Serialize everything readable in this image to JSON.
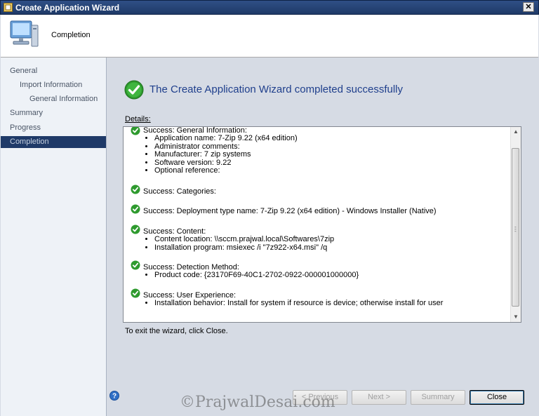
{
  "window": {
    "title": "Create Application Wizard",
    "close_glyph": "✕"
  },
  "header": {
    "page_title": "Completion",
    "icon": "computer-wizard-icon"
  },
  "nav": [
    {
      "label": "General"
    },
    {
      "label": "Import Information"
    },
    {
      "label": "General Information"
    },
    {
      "label": "Summary"
    },
    {
      "label": "Progress"
    },
    {
      "label": "Completion",
      "active": true
    }
  ],
  "main": {
    "headline": "The Create Application Wizard completed successfully",
    "details_label": "Details:",
    "entries": [
      {
        "title": "Success: General Information:",
        "items": [
          "Application name: 7-Zip 9.22 (x64 edition)",
          "Administrator comments:",
          "Manufacturer: 7 zip systems",
          "Software version: 9.22",
          "Optional reference:"
        ]
      },
      {
        "title": "Success: Categories:",
        "items": []
      },
      {
        "title": "Success: Deployment type name: 7-Zip 9.22 (x64 edition) - Windows Installer (Native)",
        "items": []
      },
      {
        "title": "Success: Content:",
        "items": [
          "Content location: \\\\sccm.prajwal.local\\Softwares\\7zip",
          "Installation program: msiexec /i \"7z922-x64.msi\" /q"
        ]
      },
      {
        "title": "Success: Detection Method:",
        "items": [
          "Product code: {23170F69-40C1-2702-0922-000001000000}"
        ]
      },
      {
        "title": "Success: User Experience:",
        "items": [
          "Installation behavior: Install for system if resource is device; otherwise install for user"
        ]
      }
    ],
    "exit_text": "To exit the wizard, click Close."
  },
  "buttons": {
    "previous": "< Previous",
    "next": "Next >",
    "summary": "Summary",
    "close": "Close"
  },
  "watermark": "©PrajwalDesai.com",
  "colors": {
    "title_bar": "#1f3a68",
    "headline": "#1f3f8c",
    "success_green": "#2e9a2e",
    "nav_active": "#1f3a68"
  }
}
